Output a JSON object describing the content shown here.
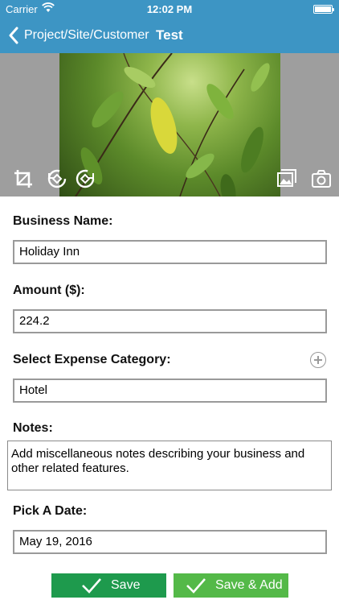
{
  "status_bar": {
    "carrier": "Carrier",
    "time": "12:02 PM"
  },
  "nav": {
    "back_label": "Project/Site/Customer",
    "title": "Test"
  },
  "photo": {
    "tools_left": [
      "crop-icon",
      "rotate-left-icon",
      "rotate-right-icon"
    ],
    "tools_right": [
      "gallery-icon",
      "camera-icon"
    ]
  },
  "form": {
    "business_name": {
      "label": "Business Name:",
      "value": "Holiday Inn"
    },
    "amount": {
      "label": "Amount ($):",
      "value": "224.2"
    },
    "category": {
      "label": "Select Expense Category:",
      "value": "Hotel"
    },
    "notes": {
      "label": "Notes:",
      "value": "Add miscellaneous notes describing your business and other related features."
    },
    "date": {
      "label": "Pick A Date:",
      "value": "May 19, 2016"
    }
  },
  "buttons": {
    "save": "Save",
    "save_add": "Save & Add"
  },
  "colors": {
    "nav_bg": "#3d95c4",
    "save_bg": "#1e9a4d",
    "save_add_bg": "#54b948"
  }
}
